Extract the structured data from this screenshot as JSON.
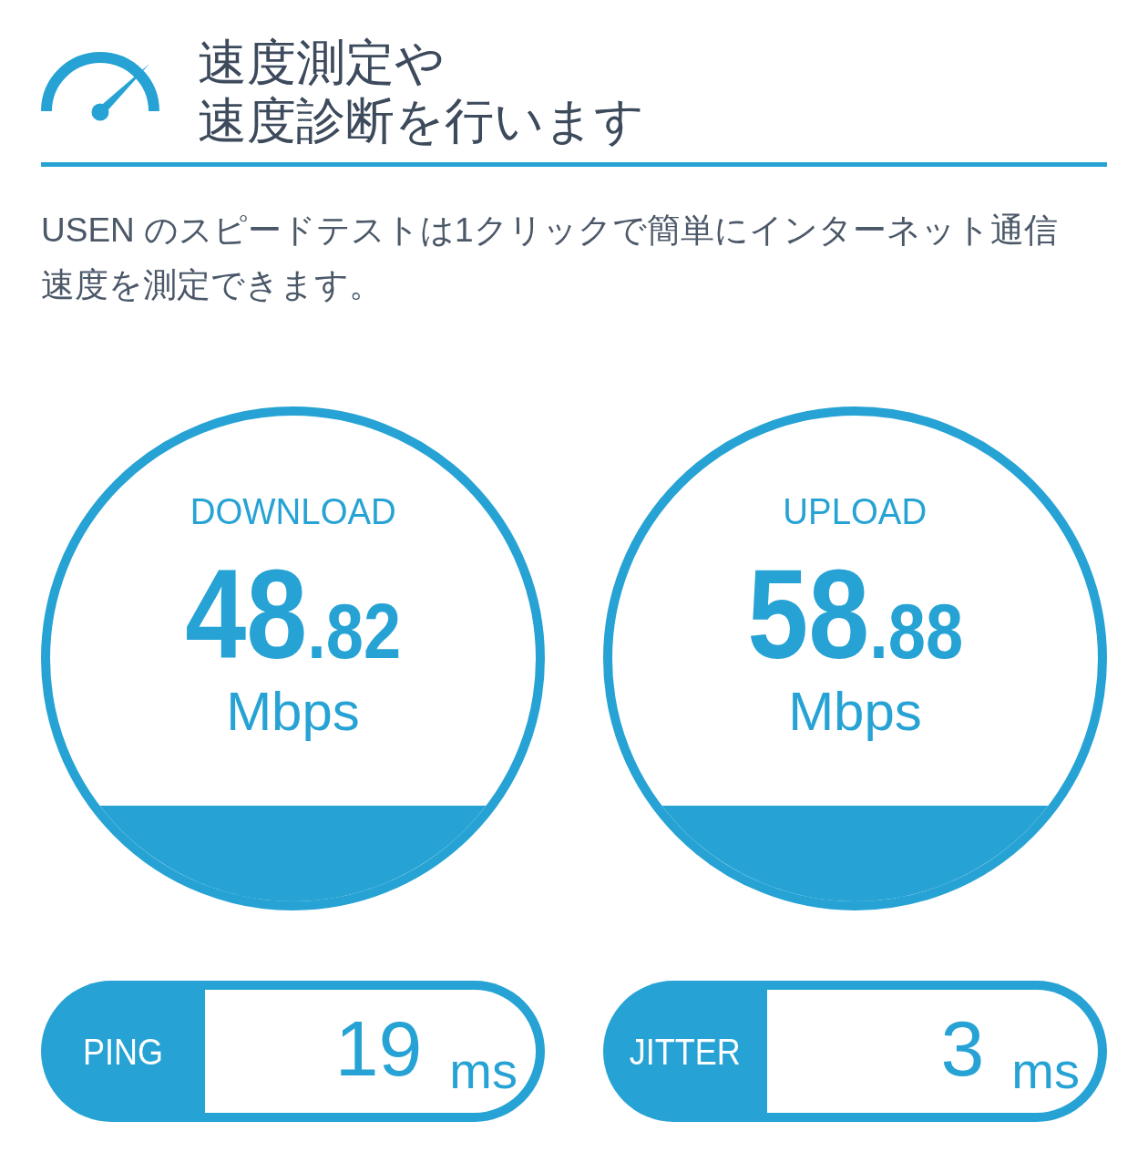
{
  "header": {
    "title_lines": [
      "速度測定や",
      "速度診断を行います"
    ]
  },
  "description": "USEN のスピードテストは1クリックで簡単にインターネット通信速度を測定できます。",
  "results": [
    {
      "label": "DOWNLOAD",
      "value": "48.82",
      "unit": "Mbps"
    },
    {
      "label": "UPLOAD",
      "value": "58.88",
      "unit": "Mbps"
    }
  ],
  "stats": [
    {
      "label": "PING",
      "value": "19",
      "unit": "ms"
    },
    {
      "label": "JITTER",
      "value": "3",
      "unit": "ms"
    }
  ]
}
